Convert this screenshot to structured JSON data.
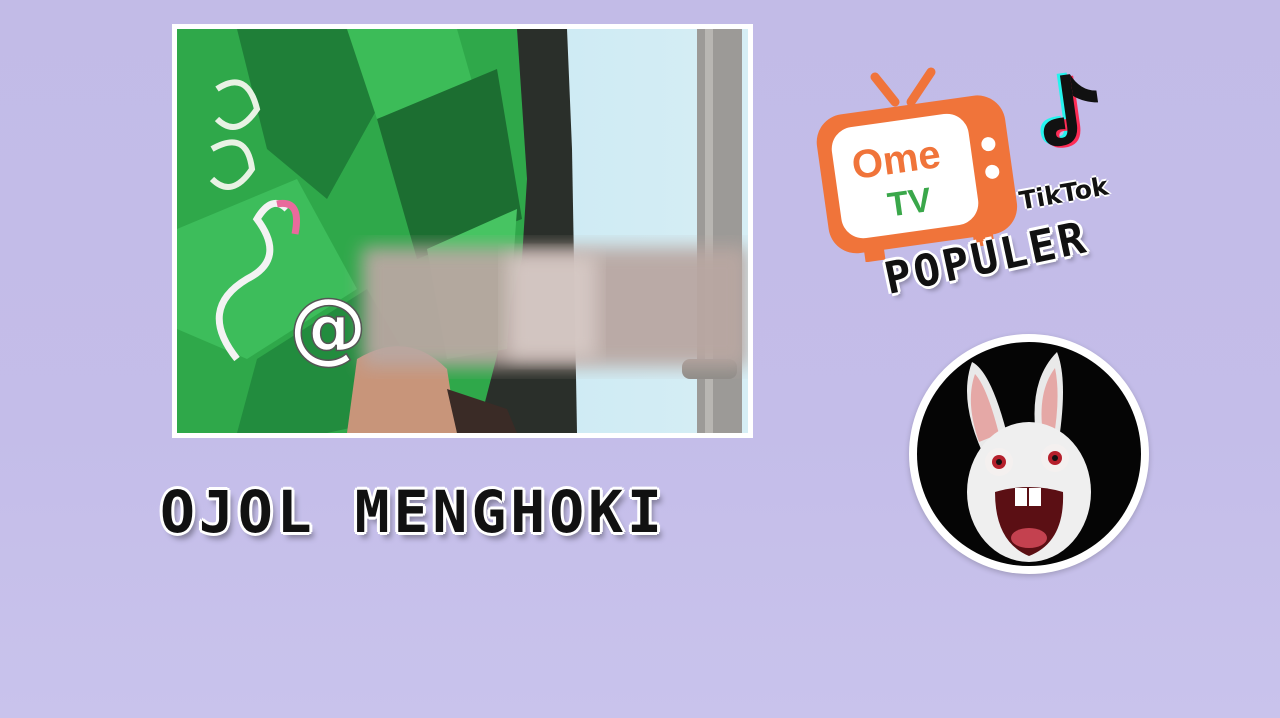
{
  "thumbnail": {
    "headline": "OJOL MENGHOKI",
    "photo_watermark": "@"
  },
  "badges": {
    "ometv": {
      "line1": "Ome",
      "line2": "TV",
      "color": "#f0743a"
    },
    "tiktok": {
      "label": "TikTok",
      "icon": "tiktok-note-icon"
    },
    "tag": "POPULER"
  },
  "avatar": {
    "icon": "rabbid-icon"
  }
}
